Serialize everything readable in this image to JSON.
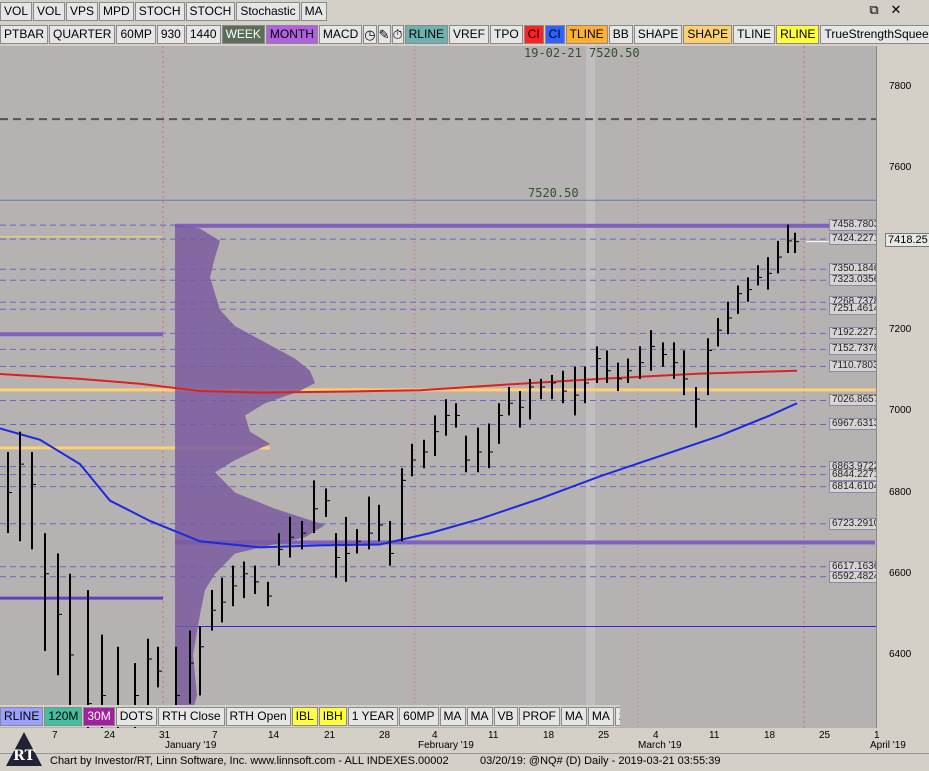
{
  "toolbar1": [
    "VOL",
    "VOL",
    "VPS",
    "MPD",
    "STOCH",
    "STOCH",
    "Stochastic",
    "MA"
  ],
  "toolbar2": [
    {
      "label": "PTBAR",
      "bg": "#e6e6e6"
    },
    {
      "label": "QUARTER",
      "bg": "#e6e6e6"
    },
    {
      "label": "60MP",
      "bg": "#e6e6e6"
    },
    {
      "label": "930",
      "bg": "#e6e6e6"
    },
    {
      "label": "1440",
      "bg": "#e6e6e6"
    },
    {
      "label": "WEEK",
      "bg": "#5a6e5a"
    },
    {
      "label": "MONTH",
      "bg": "#b060e0"
    },
    {
      "label": "MACD",
      "bg": "#e6e6e6"
    },
    {
      "icon": "clock-icon",
      "glyph": "◷"
    },
    {
      "icon": "pencil-icon",
      "glyph": "✎"
    },
    {
      "icon": "stopwatch-icon",
      "glyph": "⏱"
    },
    {
      "label": "RLINE",
      "bg": "#6fb0b0"
    },
    {
      "label": "VREF",
      "bg": "#e6e6e6"
    },
    {
      "label": "TPO",
      "bg": "#e6e6e6"
    },
    {
      "label": "CI",
      "bg": "#ff2020"
    },
    {
      "label": "CI",
      "bg": "#3060ff"
    },
    {
      "label": "TLINE",
      "bg": "#ffb030"
    },
    {
      "label": "BB",
      "bg": "#e6e6e6"
    },
    {
      "label": "SHAPE",
      "bg": "#e6e6e6"
    },
    {
      "label": "SHAPE",
      "bg": "#ffd070"
    },
    {
      "label": "TLINE",
      "bg": "#e6e6e6"
    },
    {
      "label": "RLINE",
      "bg": "#ffff40"
    },
    {
      "label": "TrueStrengthSqueeze",
      "bg": "#e6e6e6"
    },
    {
      "label": "FIB",
      "bg": "#e6e6e6"
    }
  ],
  "bottom_toolbar": [
    {
      "label": "RLINE",
      "bg": "#9aa0ff"
    },
    {
      "label": "120M",
      "bg": "#40c0a0"
    },
    {
      "label": "30M",
      "bg": "#a020a0"
    },
    {
      "label": "DOTS",
      "bg": "#e6e6e6"
    },
    {
      "label": "RTH Close",
      "bg": "#e6e6e6"
    },
    {
      "label": "RTH Open",
      "bg": "#e6e6e6"
    },
    {
      "label": "IBL",
      "bg": "#ffff40"
    },
    {
      "label": "IBH",
      "bg": "#ffff40"
    },
    {
      "label": "1 YEAR",
      "bg": "#e6e6e6"
    },
    {
      "label": "60MP",
      "bg": "#e6e6e6"
    },
    {
      "label": "MA",
      "bg": "#e6e6e6"
    },
    {
      "label": "MA",
      "bg": "#e6e6e6"
    },
    {
      "label": "VB",
      "bg": "#e6e6e6"
    },
    {
      "label": "PROF",
      "bg": "#e6e6e6"
    },
    {
      "label": "MA",
      "bg": "#e6e6e6"
    },
    {
      "label": "MA",
      "bg": "#e6e6e6"
    },
    {
      "label": "2 HR",
      "bg": "#e6e6e6"
    },
    {
      "icon": "pencil-icon",
      "glyph": "✎"
    }
  ],
  "window_controls": {
    "restore": "⧉",
    "close": "✕"
  },
  "chart": {
    "date_label": "19-02-21",
    "top_price": "7520.50",
    "mid_price": "7520.50",
    "current_price": "7418.25",
    "price_levels": [
      "7458.7803",
      "7424.2271",
      "7350.1846",
      "7323.0356",
      "7268.7378",
      "7251.4614",
      "7192.2271",
      "7152.7378",
      "7110.7803",
      "7026.8657",
      "6967.6313",
      "6863.9722",
      "6844.2271",
      "6814.6104",
      "6723.2910",
      "6617.1636",
      "6592.4824"
    ],
    "y_ticks": [
      "7800",
      "7600",
      "7200",
      "7000",
      "6800",
      "6600",
      "6400"
    ],
    "x_ticks": [
      "7",
      "24",
      "31",
      "7",
      "14",
      "21",
      "28",
      "4",
      "11",
      "18",
      "25",
      "4",
      "11",
      "18",
      "25",
      "1"
    ],
    "month_labels": [
      "January '19",
      "February '19",
      "March '19",
      "April '19"
    ]
  },
  "status": {
    "credit": "Chart by Investor/RT, Linn Software, Inc. www.linnsoft.com - ALL INDEXES.00002",
    "info": "03/20/19: @NQ# (D) Daily - 2019-03-21 03:55:39",
    "logo": "RT"
  }
}
